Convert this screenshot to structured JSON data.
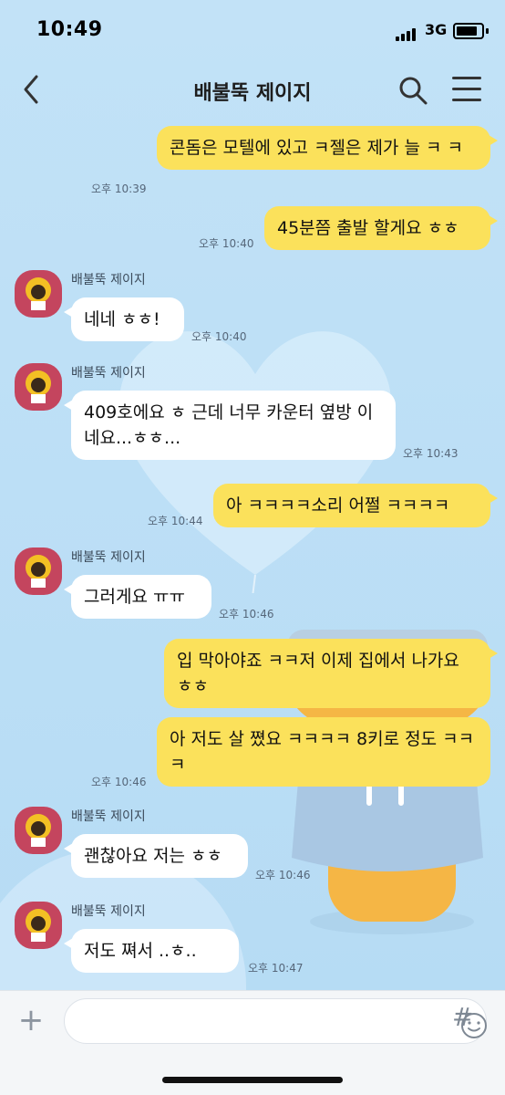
{
  "status": {
    "time": "10:49",
    "network": "3G"
  },
  "header": {
    "title": "배불뚝 제이지"
  },
  "messages": [
    {
      "text": "콘돔은 모텔에 있고 ㅋ젤은 제가 늘 ㅋ ㅋ",
      "time": "오후 10:39"
    },
    {
      "text": "45분쯤 출발 할게요 ㅎㅎ",
      "time": "오후 10:40"
    },
    {
      "sender": "배불뚝 제이지",
      "text": "네네 ㅎㅎ!",
      "time": "오후 10:40"
    },
    {
      "sender": "배불뚝 제이지",
      "text": "409호에요 ㅎ 근데 너무 카운터 옆방 이네요...ㅎㅎ...",
      "time": "오후 10:43"
    },
    {
      "text": "아 ㅋㅋㅋㅋ소리 어쩔 ㅋㅋㅋㅋ",
      "time": "오후 10:44"
    },
    {
      "sender": "배불뚝 제이지",
      "text": "그러게요 ㅠㅠ",
      "time": "오후 10:46"
    },
    {
      "text": "입 막아야죠 ㅋㅋ저 이제 집에서 나가요 ㅎㅎ"
    },
    {
      "text": "아 저도 살 쪘요 ㅋㅋㅋㅋ 8키로 정도 ㅋㅋㅋ",
      "time": "오후 10:46"
    },
    {
      "sender": "배불뚝 제이지",
      "text": "괜찮아요 저는 ㅎㅎ",
      "time": "오후 10:46"
    },
    {
      "sender": "배불뚝 제이지",
      "text": "저도 쪄서 ..ㅎ..",
      "time": "오후 10:47"
    }
  ],
  "icons": {
    "back": "chevron-left-icon",
    "search": "search-icon",
    "menu": "hamburger-menu-icon",
    "attach": "plus-icon",
    "emoji": "emoji-icon",
    "hashtag": "hashtag-icon"
  },
  "colors": {
    "my_bubble": "#fbe15b",
    "other_bubble": "#ffffff",
    "background": "#bcdff5",
    "avatar_bg": "#c4455e"
  }
}
